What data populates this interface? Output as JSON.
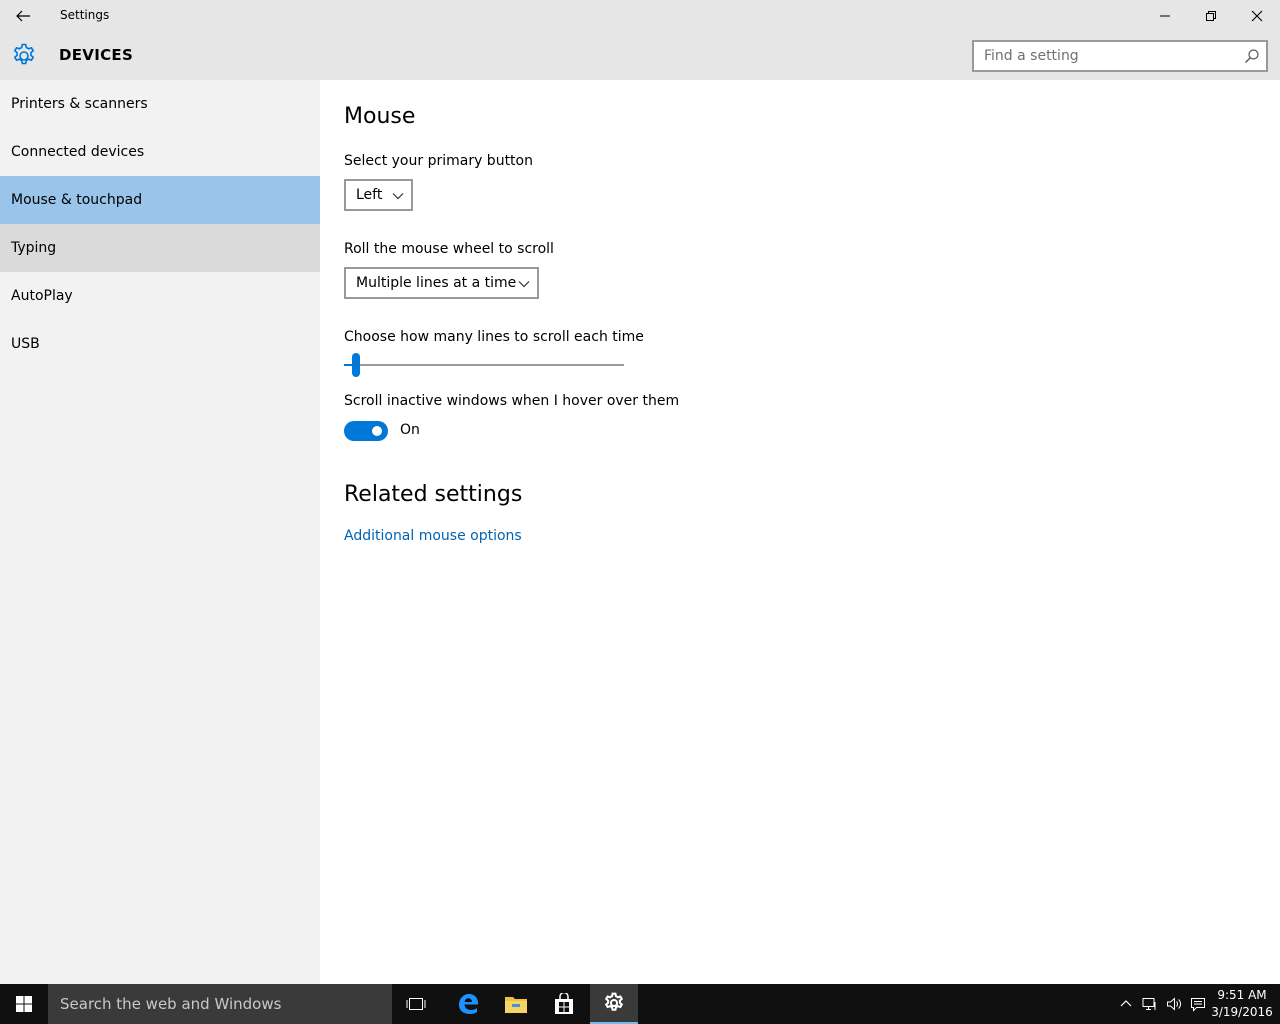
{
  "window": {
    "title": "Settings"
  },
  "header": {
    "title": "DEVICES",
    "search_placeholder": "Find a setting"
  },
  "sidebar": {
    "items": [
      {
        "label": "Printers & scanners",
        "selected": false
      },
      {
        "label": "Connected devices",
        "selected": false
      },
      {
        "label": "Mouse & touchpad",
        "selected": true
      },
      {
        "label": "Typing",
        "selected": false
      },
      {
        "label": "AutoPlay",
        "selected": false
      },
      {
        "label": "USB",
        "selected": false
      }
    ]
  },
  "main": {
    "title": "Mouse",
    "primary_button": {
      "label": "Select your primary button",
      "value": "Left"
    },
    "wheel_scroll": {
      "label": "Roll the mouse wheel to scroll",
      "value": "Multiple lines at a time"
    },
    "lines_slider": {
      "label": "Choose how many lines to scroll each time",
      "value_fraction": 0.03
    },
    "inactive_scroll": {
      "label": "Scroll inactive windows when I hover over them",
      "state": "On"
    },
    "related": {
      "title": "Related settings",
      "link": "Additional mouse options"
    }
  },
  "taskbar": {
    "search_placeholder": "Search the web and Windows",
    "time": "9:51 AM",
    "date": "3/19/2016"
  },
  "colors": {
    "accent": "#0078d7",
    "selected_nav": "#99c5ea",
    "link": "#0063b1"
  }
}
